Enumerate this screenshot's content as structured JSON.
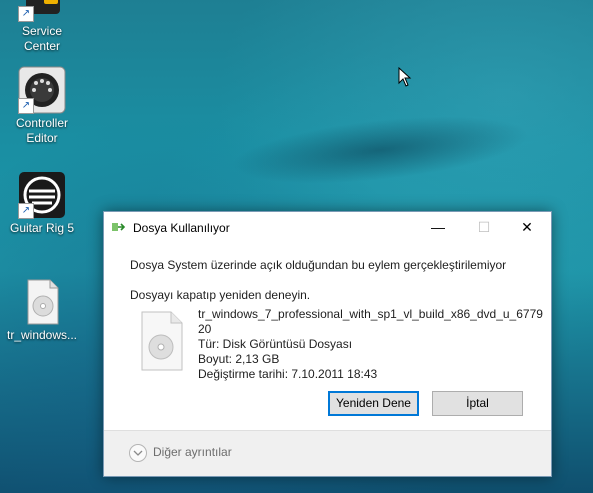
{
  "desktop": {
    "icons": [
      {
        "label_line1": "Service",
        "label_line2": "Center",
        "icon": "service-center-icon"
      },
      {
        "label_line1": "Controller",
        "label_line2": "Editor",
        "icon": "midi-controller-icon"
      },
      {
        "label_line1": "Guitar Rig 5",
        "label_line2": "",
        "icon": "guitar-rig-icon"
      },
      {
        "label_line1": "tr_windows...",
        "label_line2": "",
        "icon": "disc-image-file-icon"
      }
    ]
  },
  "dialog": {
    "title": "Dosya Kullanılıyor",
    "message": "Dosya System üzerinde açık olduğundan bu eylem gerçekleştirilemiyor",
    "hint": "Dosyayı kapatıp yeniden deneyin.",
    "file": {
      "name_line1": "tr_windows_7_professional_with_sp1_vl_build_x86_dvd_u_6779",
      "name_line2": "20",
      "type": "Tür: Disk Görüntüsü Dosyası",
      "size": "Boyut: 2,13 GB",
      "modified": "Değiştirme tarihi: 7.10.2011 18:43"
    },
    "buttons": {
      "retry": "Yeniden Dene",
      "cancel": "İptal"
    },
    "footer": {
      "more_details": "Diğer ayrıntılar"
    },
    "window_controls": {
      "minimize": "—",
      "maximize": "☐",
      "close": "✕"
    }
  },
  "colors": {
    "accent": "#0078d7",
    "desktop": "#1a8fa3"
  }
}
